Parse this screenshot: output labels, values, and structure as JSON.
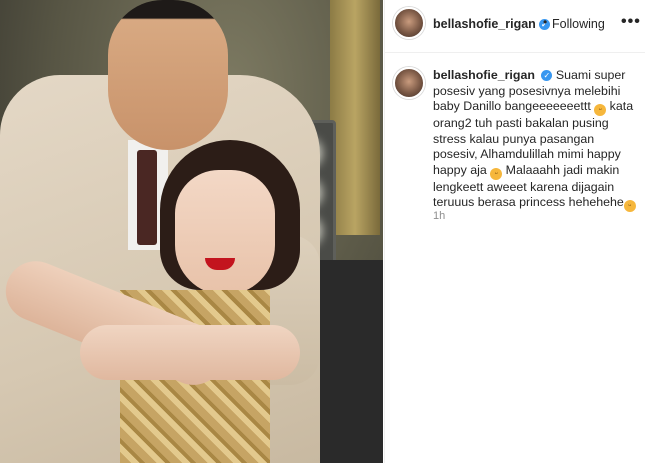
{
  "header": {
    "username": "bellashofie_rigan",
    "separator": "•",
    "follow_status": "Following",
    "more": "•••"
  },
  "caption": {
    "username": "bellashofie_rigan",
    "text_part1": "Suami super posesiv yang posesivnya melebihi baby Danillo bangeeeeeeettt",
    "text_part2": "kata orang2 tuh pasti bakalan pusing stress kalau punya pasangan posesiv, Alhamdulillah mimi happy happy aja",
    "text_part3": "Malaaahh jadi makin lengkeett aweeet karena dijagain teruuus berasa princess hehehehe"
  },
  "time_ago": "1h",
  "icons": {
    "verified": "verified-badge-icon",
    "emoji": "grinning-emoji-icon",
    "more": "more-options-icon"
  },
  "colors": {
    "verified_blue": "#3897f0",
    "secondary_text": "#8e8e8e"
  }
}
